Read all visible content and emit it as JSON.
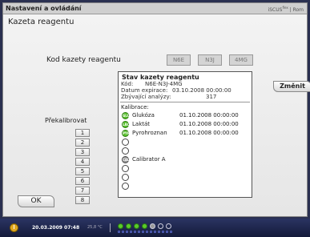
{
  "window": {
    "title": "Nastavení a ovládání",
    "brand": "iSCUS",
    "brand_sup": "flex",
    "brand_suffix": "| Rom"
  },
  "page": {
    "subtitle": "Kazeta reagentu"
  },
  "code": {
    "label": "Kod kazety reagentu",
    "parts": [
      "N6E",
      "N3J",
      "4MG"
    ]
  },
  "panel": {
    "title": "Stav kazety reagentu",
    "info": [
      {
        "label": "Kód:",
        "value": "N6E-N3J-4MG"
      },
      {
        "label": "Datum expirace:",
        "value": "03.10.2008 00:00:00"
      },
      {
        "label": "Zbývající analýzy:",
        "value": "317"
      }
    ],
    "calibration_label": "Kalibrace:",
    "calibrations": [
      {
        "abbr": "GLU",
        "name": "Glukóza",
        "date": "01.10.2008 00:00:00",
        "state": "green"
      },
      {
        "abbr": "LAC",
        "name": "Laktát",
        "date": "01.10.2008 00:00:00",
        "state": "green"
      },
      {
        "abbr": "PYR",
        "name": "Pyrohroznan",
        "date": "01.10.2008 00:00:00",
        "state": "green"
      },
      {
        "abbr": "",
        "name": "",
        "date": "",
        "state": "empty"
      },
      {
        "abbr": "",
        "name": "",
        "date": "",
        "state": "empty"
      },
      {
        "abbr": "CAL",
        "name": "Calibrator A",
        "date": "",
        "state": "grey"
      },
      {
        "abbr": "",
        "name": "",
        "date": "",
        "state": "empty"
      },
      {
        "abbr": "",
        "name": "",
        "date": "",
        "state": "empty"
      },
      {
        "abbr": "",
        "name": "",
        "date": "",
        "state": "empty"
      }
    ]
  },
  "buttons": {
    "change": "Změnit",
    "ok": "OK",
    "recalibrate_label": "Překalibrovat",
    "numbers": [
      "1",
      "2",
      "3",
      "4",
      "5",
      "6",
      "7",
      "8"
    ]
  },
  "statusbar": {
    "datetime": "20.03.2009 07:48",
    "temperature": "25,8 °C",
    "dots": [
      "green",
      "green",
      "green",
      "green",
      "grey",
      "empty",
      "empty"
    ]
  }
}
